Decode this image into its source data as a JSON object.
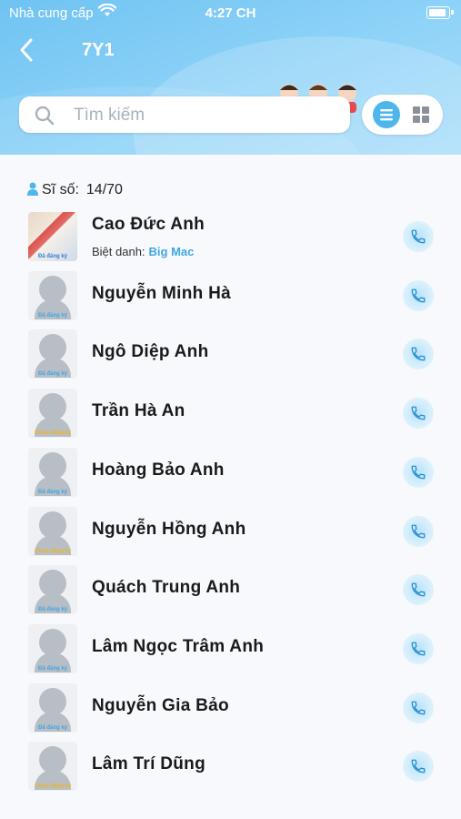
{
  "status_bar": {
    "carrier": "Nhà cung cấp",
    "time": "4:27 CH"
  },
  "header": {
    "title": "7Y1"
  },
  "search": {
    "placeholder": "Tìm kiếm"
  },
  "class_size": {
    "label": "Sĩ số:",
    "value": "14/70"
  },
  "nickname_label": "Biệt danh:",
  "status_labels": {
    "registered": "Đã đăng ký",
    "unregistered": "Chưa đăng ký"
  },
  "colors": {
    "accent": "#4eb6ec",
    "header": "#7ccaf5",
    "unregistered": "#f0b51e"
  },
  "students": [
    {
      "name": "Cao Đức Anh",
      "nickname": "Big Mac",
      "avatar": "photo",
      "status": "registered"
    },
    {
      "name": "Nguyễn Minh Hà",
      "avatar": "placeholder",
      "status": "registered"
    },
    {
      "name": "Ngô Diệp Anh",
      "avatar": "placeholder",
      "status": "registered"
    },
    {
      "name": "Trần Hà An",
      "avatar": "placeholder",
      "status": "unregistered"
    },
    {
      "name": "Hoàng Bảo Anh",
      "avatar": "placeholder",
      "status": "registered"
    },
    {
      "name": "Nguyễn Hồng Anh",
      "avatar": "placeholder",
      "status": "unregistered"
    },
    {
      "name": "Quách Trung Anh",
      "avatar": "placeholder",
      "status": "registered"
    },
    {
      "name": "Lâm Ngọc Trâm Anh",
      "avatar": "placeholder",
      "status": "registered"
    },
    {
      "name": "Nguyễn Gia Bảo",
      "avatar": "placeholder",
      "status": "registered"
    },
    {
      "name": "Lâm Trí Dũng",
      "avatar": "placeholder",
      "status": "unregistered"
    }
  ]
}
